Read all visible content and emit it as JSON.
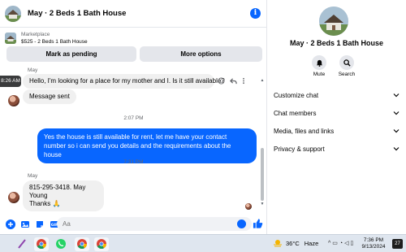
{
  "chat": {
    "title": "May · 2 Beds 1 Bath House",
    "marketplace_label": "Marketplace",
    "listing_line": "$525 - 2 Beds 1 Bath House",
    "mark_pending": "Mark as pending",
    "more_options": "More options"
  },
  "messages": {
    "sender1": "May",
    "hover_time": "8:26 AM",
    "msg1": "Hello, I'm looking for a place for my mother and I. Is it still available?",
    "msg2": "Message sent",
    "ts1": "2:07 PM",
    "out1": "Yes the house is still available for rent, let me have your contact number so i can send you details and the requirements about the house",
    "ts2": "7:31 PM",
    "sender2": "May",
    "msg3_line1": "815-295-3418.  May Young",
    "msg3_line2": "Thanks 🙏"
  },
  "composer": {
    "placeholder": "Aa"
  },
  "panel": {
    "name": "May · 2 Beds 1 Bath House",
    "mute": "Mute",
    "search": "Search",
    "menu": [
      "Customize chat",
      "Chat members",
      "Media, files and links",
      "Privacy & support"
    ]
  },
  "taskbar": {
    "temp": "36°C",
    "weather": "Haze",
    "time": "7:36 PM",
    "date": "9/13/2024",
    "notifications": "27"
  },
  "colors": {
    "accent": "#0866ff",
    "bubble_in": "#f0f0f0"
  }
}
